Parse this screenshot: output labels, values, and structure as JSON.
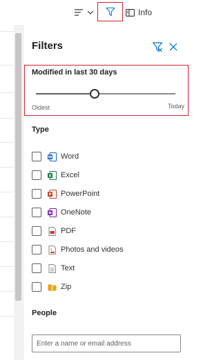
{
  "toolbar": {
    "view_icon": "view-options-icon",
    "chevron_icon": "chevron-down-icon",
    "filter_icon": "filter-icon",
    "info_icon": "info-panel-icon",
    "info_label": "Info"
  },
  "filters": {
    "title": "Filters",
    "clear_icon": "clear-filter-icon",
    "close_icon": "close-icon",
    "date": {
      "title": "Modified in last 30 days",
      "min_label": "Oldest",
      "max_label": "Today",
      "value_fraction": 0.42
    },
    "type": {
      "heading": "Type",
      "items": [
        {
          "label": "Word",
          "icon": "word-icon",
          "checked": false
        },
        {
          "label": "Excel",
          "icon": "excel-icon",
          "checked": false
        },
        {
          "label": "PowerPoint",
          "icon": "powerpoint-icon",
          "checked": false
        },
        {
          "label": "OneNote",
          "icon": "onenote-icon",
          "checked": false
        },
        {
          "label": "PDF",
          "icon": "pdf-icon",
          "checked": false
        },
        {
          "label": "Photos and videos",
          "icon": "photo-icon",
          "checked": false
        },
        {
          "label": "Text",
          "icon": "text-file-icon",
          "checked": false
        },
        {
          "label": "Zip",
          "icon": "zip-icon",
          "checked": false
        }
      ]
    },
    "people": {
      "heading": "People",
      "placeholder": "Enter a name or email address",
      "value": ""
    }
  },
  "colors": {
    "accent": "#0078d4",
    "highlight": "#d01e2b",
    "word": "#185abd",
    "excel": "#107c41",
    "powerpoint": "#c43e1c",
    "onenote": "#7719aa",
    "pdf": "#d13438",
    "zip": "#e8a317"
  }
}
